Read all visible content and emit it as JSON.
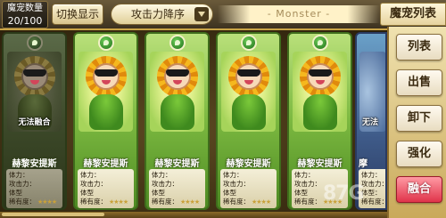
{
  "header": {
    "count_label": "魔宠数量",
    "count_value": "20/100",
    "toggle_label": "切换显示",
    "sort_label": "攻击力降序",
    "banner_text": "- Monster -",
    "panel_title": "魔宠列表"
  },
  "cards": [
    {
      "name": "赫黎安提斯",
      "cannot_merge": "无法融合",
      "dim": true,
      "stats": {
        "hp": "体力：",
        "atk": "攻击力：",
        "type": "体型",
        "rarity": "稀有度："
      },
      "stars": "★★★★"
    },
    {
      "name": "赫黎安提斯",
      "cannot_merge": "",
      "dim": false,
      "stats": {
        "hp": "体力：",
        "atk": "攻击力：",
        "type": "体型",
        "rarity": "稀有度："
      },
      "stars": "★★★★"
    },
    {
      "name": "赫黎安提斯",
      "cannot_merge": "",
      "dim": false,
      "stats": {
        "hp": "体力：",
        "atk": "攻击力：",
        "type": "体型",
        "rarity": "稀有度："
      },
      "stars": "★★★★"
    },
    {
      "name": "赫黎安提斯",
      "cannot_merge": "",
      "dim": false,
      "stats": {
        "hp": "体力：",
        "atk": "攻击力：",
        "type": "体型",
        "rarity": "稀有度："
      },
      "stars": "★★★★"
    },
    {
      "name": "赫黎安提斯",
      "cannot_merge": "",
      "dim": false,
      "stats": {
        "hp": "体力：",
        "atk": "攻击力：",
        "type": "体型",
        "rarity": "稀有度："
      },
      "stars": "★★★★"
    }
  ],
  "peek_card": {
    "name": "摩",
    "stats": {
      "hp": "体力：",
      "atk": "攻击力：",
      "type": "体型：",
      "rarity": "稀有度："
    }
  },
  "partial_label": "无法",
  "side_menu": {
    "list": "列表",
    "sell": "出售",
    "unequip": "卸下",
    "enhance": "强化",
    "merge": "融合"
  },
  "watermark": "87G"
}
